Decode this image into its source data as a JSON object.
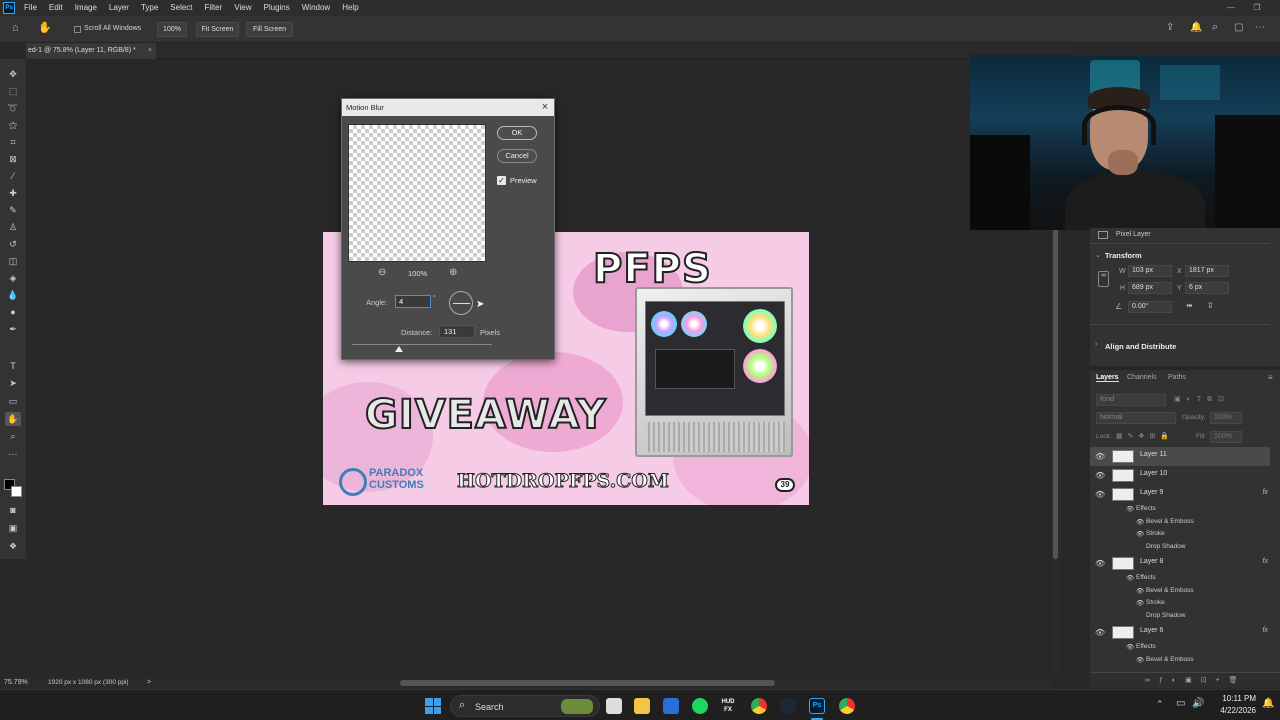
{
  "menubar": {
    "logo": "Ps",
    "items": [
      "File",
      "Edit",
      "Image",
      "Layer",
      "Type",
      "Select",
      "Filter",
      "View",
      "Plugins",
      "Window",
      "Help"
    ]
  },
  "optionsbar": {
    "scroll_all": "Scroll All Windows",
    "zoom_btn": "100%",
    "fit_screen": "Fit Screen",
    "fill_screen": "Fill Screen"
  },
  "doc_tab": {
    "title": "ed-1 @ 75.8% (Layer 11, RGB/8) *",
    "close": "×"
  },
  "artwork": {
    "headline_top": "PFPS",
    "headline_main": "GIVEAWAY",
    "brand_line1": "PARADOX",
    "brand_line2": "CUSTOMS",
    "url": "HOTDROPFPS.COM",
    "badge": "39"
  },
  "dialog": {
    "title": "Motion Blur",
    "ok": "OK",
    "cancel": "Cancel",
    "preview_label": "Preview",
    "preview_checked": true,
    "zoom_level": "100%",
    "angle_label": "Angle:",
    "angle_value": "4",
    "degree_symbol": "°",
    "distance_label": "Distance:",
    "distance_value": "131",
    "distance_unit": "Pixels"
  },
  "status": {
    "zoom": "75.79%",
    "doc_size": "1920 px x 1080 px (300 ppi)",
    "arrow": ">"
  },
  "properties": {
    "layer_type": "Pixel Layer",
    "transform_title": "Transform",
    "w_label": "W",
    "w_value": "103 px",
    "h_label": "H",
    "h_value": "689 px",
    "x_label": "X",
    "x_value": "1817 px",
    "y_label": "Y",
    "y_value": "6 px",
    "angle_value": "0.00°",
    "align_title": "Align and Distribute"
  },
  "layers_panel": {
    "tabs": [
      "Layers",
      "Channels",
      "Paths"
    ],
    "kind_placeholder": "Kind",
    "blend_mode": "Normal",
    "opacity_label": "Opacity:",
    "opacity_value": "100%",
    "lock_label": "Lock:",
    "fill_label": "Fill:",
    "fill_value": "100%",
    "layers": [
      {
        "name": "Layer 11"
      },
      {
        "name": "Layer 10"
      },
      {
        "name": "Layer 9",
        "fx": "fx"
      },
      {
        "name": "Layer 8",
        "fx": "fx"
      },
      {
        "name": "Layer 6",
        "fx": "fx"
      }
    ],
    "effects_label": "Effects",
    "effect_bevel": "Bevel & Emboss",
    "effect_stroke": "Stroke",
    "effect_shadow": "Drop Shadow"
  },
  "taskbar": {
    "search": "Search",
    "time": "10:11 PM",
    "date": "4/22/2026"
  },
  "colors": {
    "accent": "#31a8ff",
    "menubar": "#2d2d2d",
    "panel": "#323232",
    "taskbar": "#1f1f1f"
  }
}
